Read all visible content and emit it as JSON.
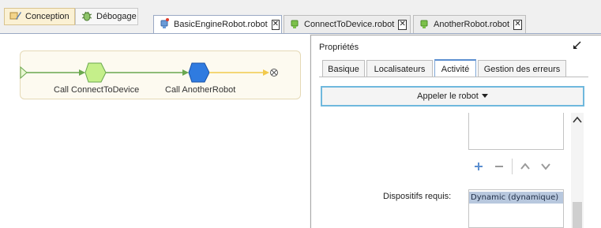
{
  "mode_tabs": [
    {
      "label": "Conception",
      "active": true,
      "icon": "pencil-ruler-icon"
    },
    {
      "label": "Débogage",
      "active": false,
      "icon": "bug-icon"
    }
  ],
  "editor_tabs": [
    {
      "label": "BasicEngineRobot.robot",
      "active": true,
      "icon": "robot-icon"
    },
    {
      "label": "ConnectToDevice.robot",
      "active": false,
      "icon": "robot-icon"
    },
    {
      "label": "AnotherRobot.robot",
      "active": false,
      "icon": "robot-icon"
    }
  ],
  "canvas": {
    "steps": [
      {
        "label": "Call ConnectToDevice"
      },
      {
        "label": "Call AnotherRobot"
      }
    ]
  },
  "properties": {
    "title": "Propriétés",
    "tabs": [
      {
        "label": "Basique",
        "active": false
      },
      {
        "label": "Localisateurs",
        "active": false
      },
      {
        "label": "Activité",
        "active": true
      },
      {
        "label": "Gestion des erreurs",
        "active": false
      }
    ],
    "call_button": "Appeler le robot",
    "required_devices_label": "Dispositifs requis:",
    "required_devices": [
      "Dynamic (dynamique)"
    ]
  },
  "colors": {
    "accent": "#6fb8dd",
    "step1_fill": "#c5ef8a",
    "step2_fill": "#2f7be0",
    "connector": "#6aa84f",
    "end_connector": "#f2c94c"
  }
}
